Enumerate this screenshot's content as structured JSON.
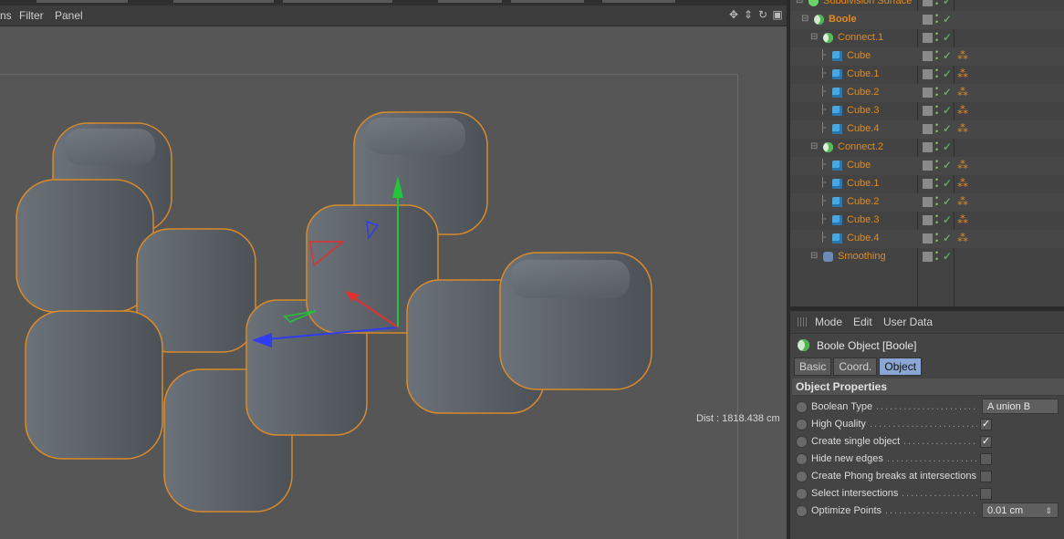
{
  "menubar": {
    "items": [
      "ns",
      "Filter",
      "Panel"
    ]
  },
  "viewport": {
    "hud_text": "Dist : 1818.438 cm"
  },
  "object_manager": {
    "rows": [
      {
        "name": "Subdivision Surface",
        "icon": "subdivision-icon",
        "indent": 0,
        "bold": false,
        "tag": false
      },
      {
        "name": "Boole",
        "icon": "boole-icon",
        "indent": 1,
        "bold": true,
        "tag": false
      },
      {
        "name": "Connect.1",
        "icon": "connect-icon",
        "indent": 2,
        "bold": false,
        "tag": false
      },
      {
        "name": "Cube",
        "icon": "cube-icon",
        "indent": 3,
        "bold": false,
        "tag": true
      },
      {
        "name": "Cube.1",
        "icon": "cube-icon",
        "indent": 3,
        "bold": false,
        "tag": true
      },
      {
        "name": "Cube.2",
        "icon": "cube-icon",
        "indent": 3,
        "bold": false,
        "tag": true
      },
      {
        "name": "Cube.3",
        "icon": "cube-icon",
        "indent": 3,
        "bold": false,
        "tag": true
      },
      {
        "name": "Cube.4",
        "icon": "cube-icon",
        "indent": 3,
        "bold": false,
        "tag": true
      },
      {
        "name": "Connect.2",
        "icon": "connect-icon",
        "indent": 2,
        "bold": false,
        "tag": false
      },
      {
        "name": "Cube",
        "icon": "cube-icon",
        "indent": 3,
        "bold": false,
        "tag": true
      },
      {
        "name": "Cube.1",
        "icon": "cube-icon",
        "indent": 3,
        "bold": false,
        "tag": true
      },
      {
        "name": "Cube.2",
        "icon": "cube-icon",
        "indent": 3,
        "bold": false,
        "tag": true
      },
      {
        "name": "Cube.3",
        "icon": "cube-icon",
        "indent": 3,
        "bold": false,
        "tag": true
      },
      {
        "name": "Cube.4",
        "icon": "cube-icon",
        "indent": 3,
        "bold": false,
        "tag": true
      },
      {
        "name": "Smoothing",
        "icon": "smoothing-icon",
        "indent": 2,
        "bold": false,
        "tag": false
      }
    ]
  },
  "attributes": {
    "menu": [
      "Mode",
      "Edit",
      "User Data"
    ],
    "title": "Boole Object [Boole]",
    "tabs": [
      {
        "label": "Basic",
        "active": false
      },
      {
        "label": "Coord.",
        "active": false
      },
      {
        "label": "Object",
        "active": true
      }
    ],
    "section": "Object Properties",
    "props": [
      {
        "label": "Boolean Type",
        "type": "select",
        "value": "A union B"
      },
      {
        "label": "High Quality",
        "type": "checkbox",
        "checked": true
      },
      {
        "label": "Create single object",
        "type": "checkbox",
        "checked": true
      },
      {
        "label": "Hide new edges",
        "type": "checkbox",
        "checked": false
      },
      {
        "label": "Create Phong breaks at intersections",
        "type": "checkbox",
        "checked": false
      },
      {
        "label": "Select intersections",
        "type": "checkbox",
        "checked": false
      },
      {
        "label": "Optimize Points",
        "type": "number",
        "value": "0.01 cm"
      }
    ]
  },
  "colors": {
    "object_name": "#e48a1c",
    "active_tab": "#8aa6d4",
    "x_axis": "#2f3cf0",
    "y_axis": "#22c43a",
    "z_axis": "#e03030",
    "mesh": "#5f656c",
    "selection_outline": "#d98a2a"
  }
}
